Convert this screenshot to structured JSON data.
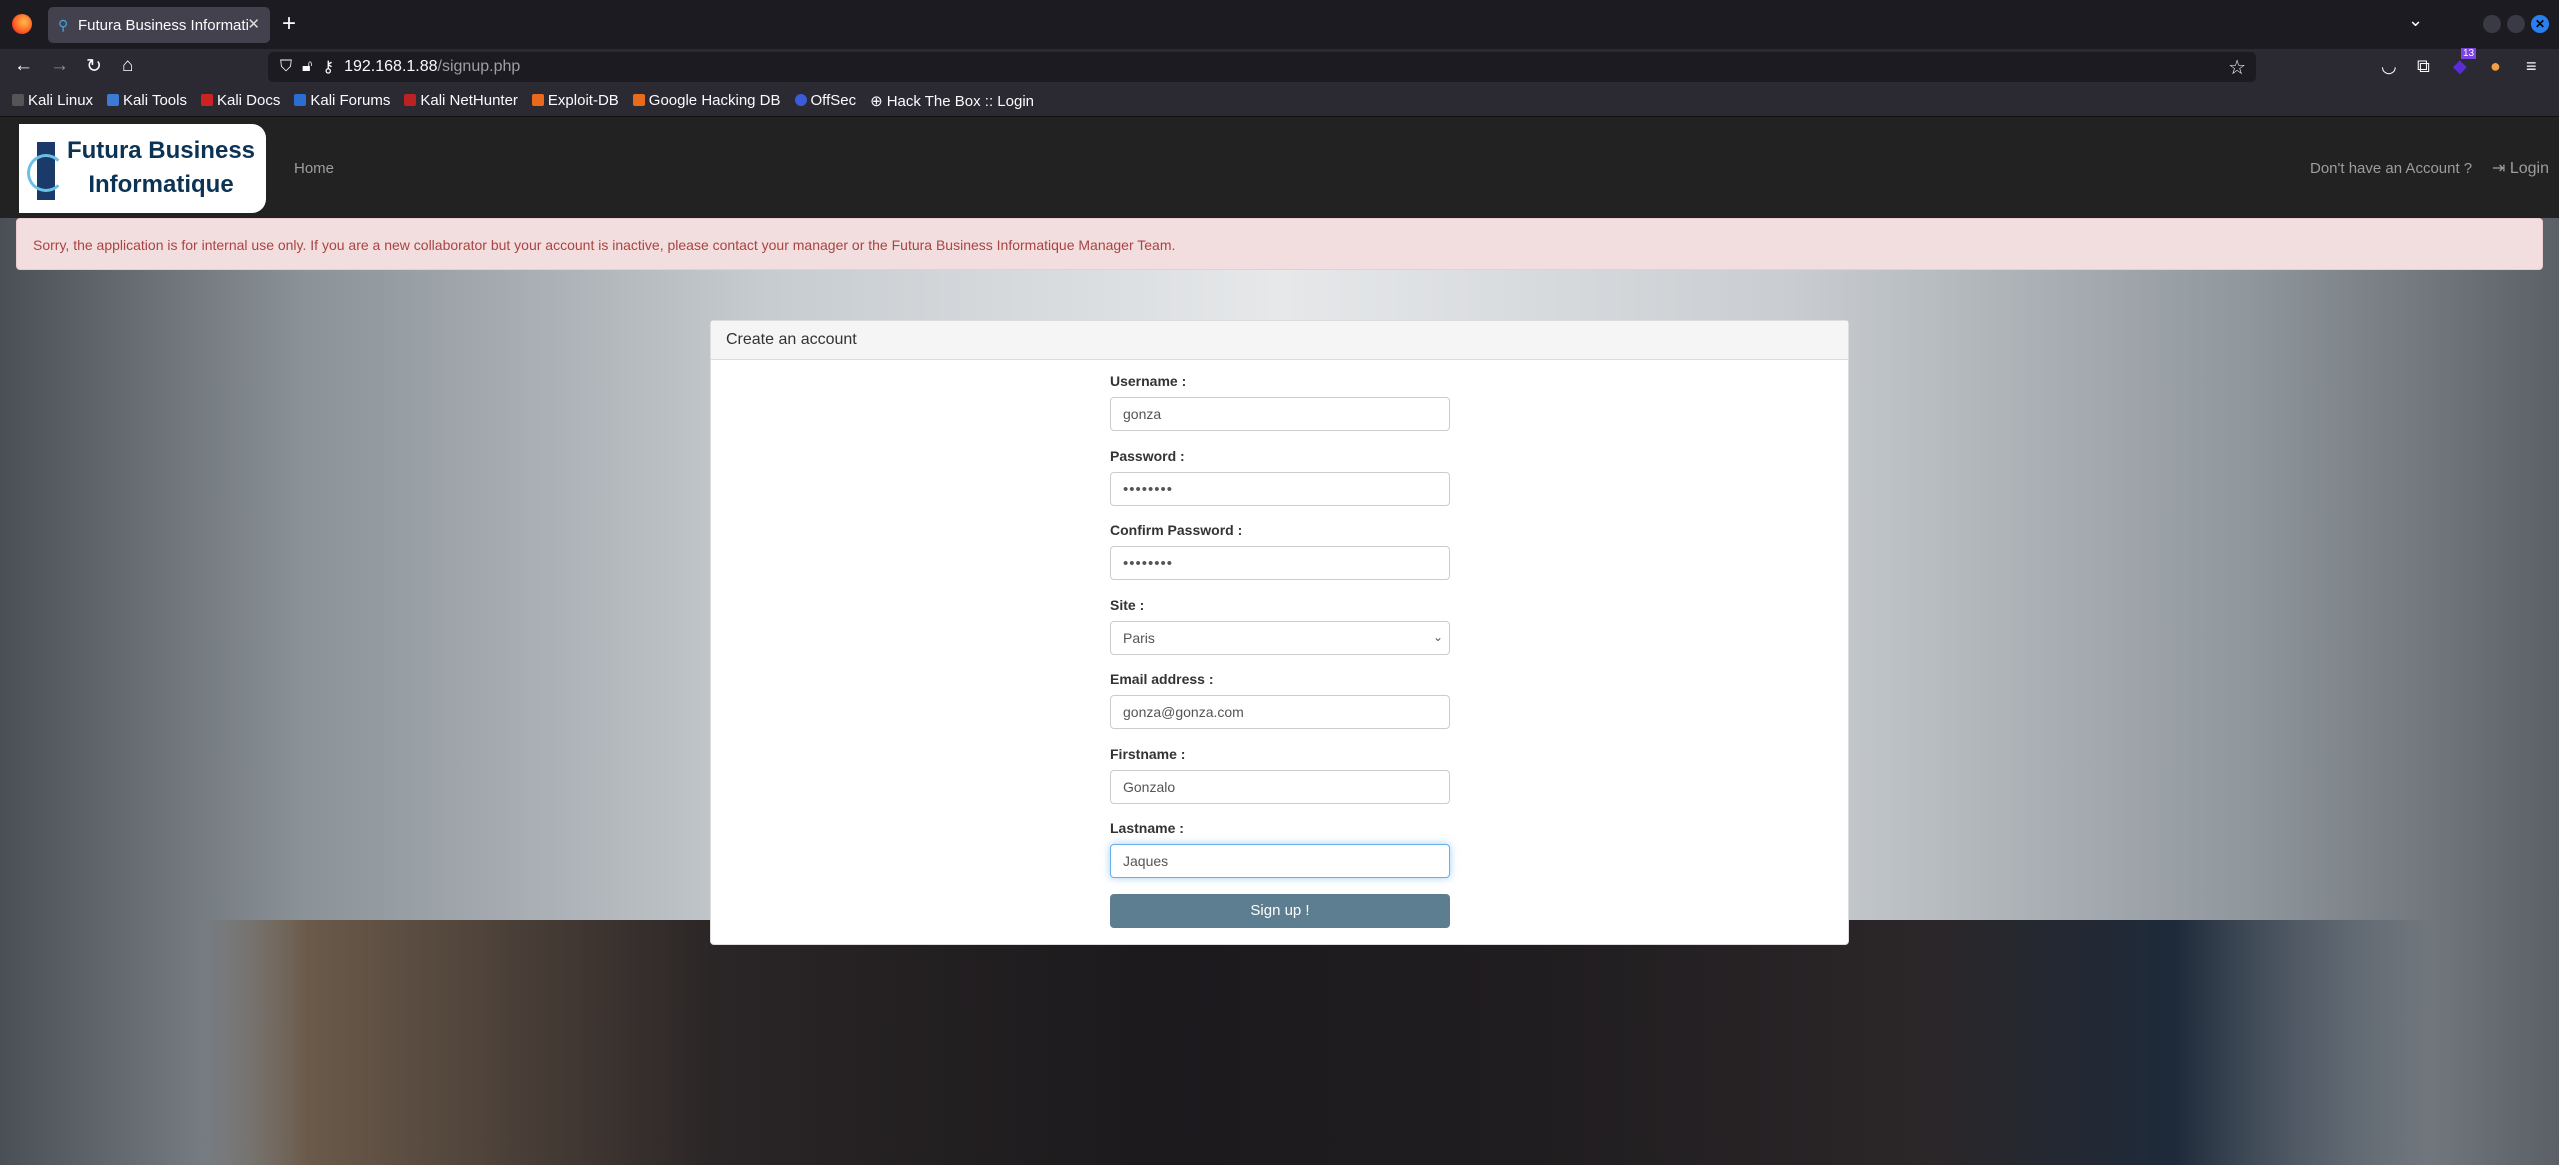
{
  "browser": {
    "tab_title": "Futura Business Informati",
    "url_host": "192.168.1.88",
    "url_path": "/signup.php",
    "badge_count": "13",
    "bookmarks": [
      "Kali Linux",
      "Kali Tools",
      "Kali Docs",
      "Kali Forums",
      "Kali NetHunter",
      "Exploit-DB",
      "Google Hacking DB",
      "OffSec",
      "Hack The Box :: Login"
    ]
  },
  "site": {
    "logo_line1": "Futura Business",
    "logo_line2": "Informatique",
    "nav_home": "Home",
    "nav_no_account": "Don't have an Account ?",
    "nav_login": "Login",
    "alert": "Sorry, the application is for internal use only. If you are a new collaborator but your account is inactive, please contact your manager or the Futura Business Informatique Manager Team."
  },
  "form": {
    "title": "Create an account",
    "username_label": "Username :",
    "username": "gonza",
    "password_label": "Password :",
    "password": "••••••••",
    "confirm_label": "Confirm Password :",
    "confirm": "••••••••",
    "site_label": "Site :",
    "site": "Paris",
    "email_label": "Email address :",
    "email": "gonza@gonza.com",
    "firstname_label": "Firstname :",
    "firstname": "Gonzalo",
    "lastname_label": "Lastname :",
    "lastname": "Jaques",
    "submit": "Sign up !"
  }
}
